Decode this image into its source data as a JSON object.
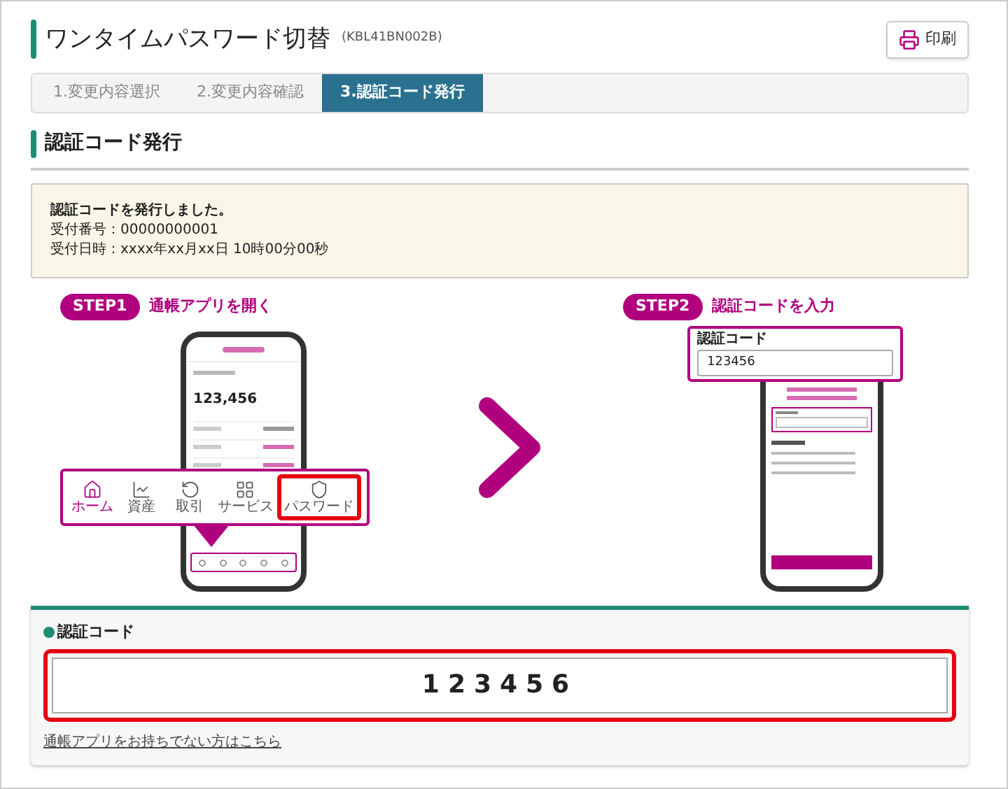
{
  "window": {
    "title": "ワンタイムパスワード切替",
    "screen_id": "(KBL41BN002B)"
  },
  "print_button": {
    "label": "印刷"
  },
  "steps": [
    {
      "label": "1.変更内容選択",
      "selected": false
    },
    {
      "label": "2.変更内容確認",
      "selected": false
    },
    {
      "label": "3.認証コード発行",
      "selected": true
    }
  ],
  "section": {
    "title": "認証コード発行"
  },
  "notice": {
    "lines": [
      "認証コードを発行しました。",
      "受付番号：00000000001",
      "受付日時：xxxx年xx月xx日 10時00分00秒"
    ]
  },
  "guide": {
    "step1": {
      "badge": "STEP1",
      "title": "通帳アプリを開く",
      "balance": "123,456",
      "nav": [
        {
          "label": "ホーム",
          "selected": true,
          "highlighted": false
        },
        {
          "label": "資産",
          "selected": false,
          "highlighted": false
        },
        {
          "label": "取引",
          "selected": false,
          "highlighted": false
        },
        {
          "label": "サービス",
          "selected": false,
          "highlighted": false
        },
        {
          "label": "パスワード",
          "selected": false,
          "highlighted": true
        }
      ]
    },
    "step2": {
      "badge": "STEP2",
      "title": "認証コードを入力",
      "field_label": "認証コード",
      "field_value": "123456"
    }
  },
  "code_panel": {
    "label": "認証コード",
    "code": "123456",
    "link": "通帳アプリをお持ちでない方はこちら"
  }
}
